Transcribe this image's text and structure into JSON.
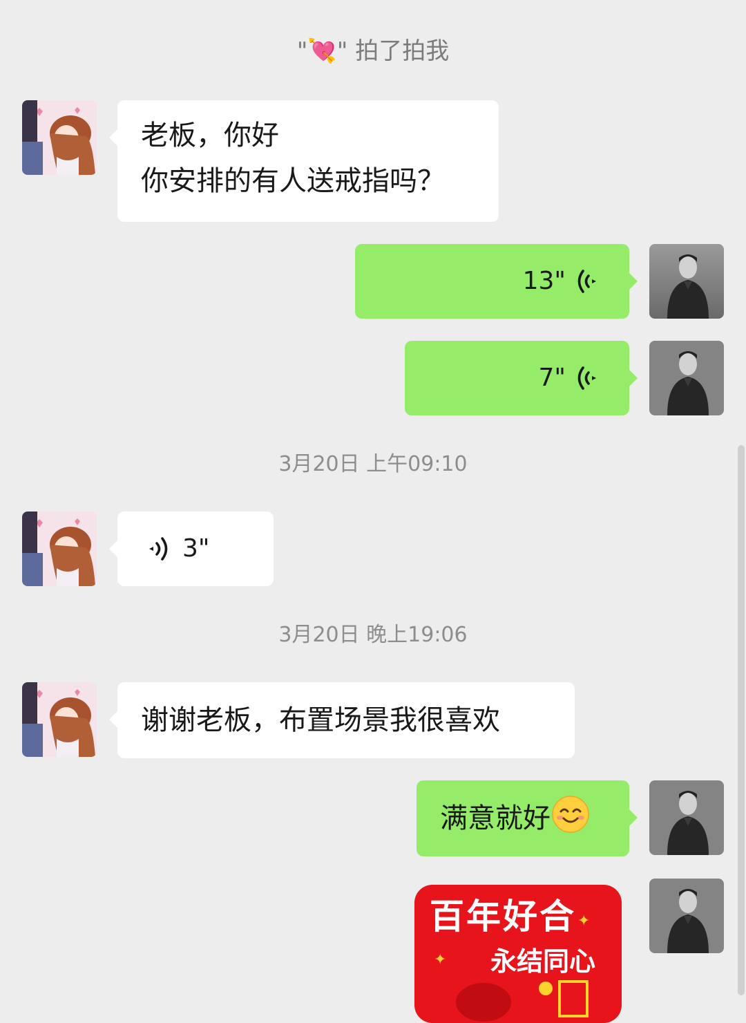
{
  "chat": {
    "pat_quote_open": "\"",
    "pat_emoji": "💘",
    "pat_quote_close": "\"",
    "pat_action": "拍了拍我",
    "messages": {
      "m1": {
        "line1": "老板，你好",
        "line2": "你安排的有人送戒指吗？"
      },
      "m2": {
        "duration": "13\""
      },
      "m3": {
        "duration": "7\""
      },
      "m4": {
        "duration": "3\""
      },
      "m5": {
        "text": "谢谢老板，布置场景我很喜欢"
      },
      "m6": {
        "text": "满意就好"
      }
    },
    "timestamps": {
      "t1": "3月20日 上午09:10",
      "t2": "3月20日 晚上19:06"
    },
    "sticker": {
      "title": "百年好合",
      "subtitle": "永结同心"
    }
  },
  "icons": {
    "voice": "voice-wave-icon",
    "smile": "smile-emoji-icon",
    "pat": "heart-arrow-emoji"
  },
  "colors": {
    "background": "#ededed",
    "sent_bubble": "#95ec69",
    "received_bubble": "#ffffff",
    "timestamp_text": "#8d8d8d",
    "sticker_red": "#e8141c"
  }
}
